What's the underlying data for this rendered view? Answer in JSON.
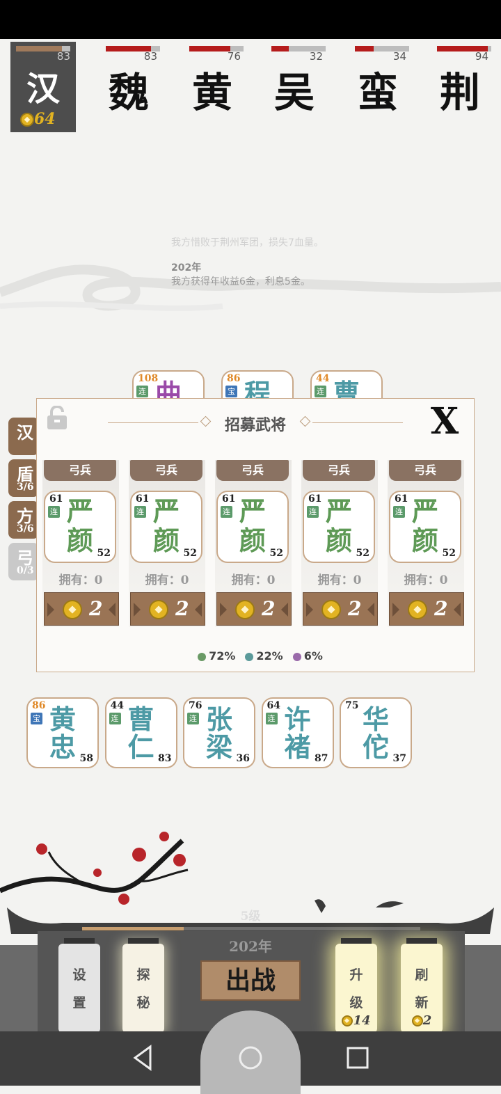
{
  "factions": [
    {
      "char": "汉",
      "hp": 83,
      "hp_ratio": 0.85,
      "gold": "64",
      "active": true
    },
    {
      "char": "魏",
      "hp": 83,
      "hp_ratio": 0.83
    },
    {
      "char": "黄",
      "hp": 76,
      "hp_ratio": 0.76
    },
    {
      "char": "吴",
      "hp": 32,
      "hp_ratio": 0.32
    },
    {
      "char": "蛮",
      "hp": 34,
      "hp_ratio": 0.34
    },
    {
      "char": "荆",
      "hp": 94,
      "hp_ratio": 0.94
    }
  ],
  "log": {
    "line1": "我方惜败于荆州军团，损失7血量。",
    "year": "202年",
    "line3": "我方获得年收益6金，利息5金。"
  },
  "top_cards": [
    {
      "level": "108",
      "tag": "连",
      "name": "曲"
    },
    {
      "level": "86",
      "tag": "宝",
      "name": "程"
    },
    {
      "level": "44",
      "tag": "连",
      "name": "曹"
    }
  ],
  "side_tabs": [
    {
      "t1": "汉",
      "t2": ""
    },
    {
      "t1": "盾",
      "t2": "3/6"
    },
    {
      "t1": "方",
      "t2": "3/6"
    },
    {
      "t1": "弓",
      "t2": "0/3"
    }
  ],
  "dialog": {
    "title": "招募武将",
    "close": "X",
    "slots": [
      {
        "type": "弓兵",
        "level": "61",
        "tag": "连",
        "name1": "严",
        "name2": "颜",
        "power": "52",
        "own": "拥有：0",
        "cost": "2"
      },
      {
        "type": "弓兵",
        "level": "61",
        "tag": "连",
        "name1": "严",
        "name2": "颜",
        "power": "52",
        "own": "拥有：0",
        "cost": "2"
      },
      {
        "type": "弓兵",
        "level": "61",
        "tag": "连",
        "name1": "严",
        "name2": "颜",
        "power": "52",
        "own": "拥有：0",
        "cost": "2"
      },
      {
        "type": "弓兵",
        "level": "61",
        "tag": "连",
        "name1": "严",
        "name2": "颜",
        "power": "52",
        "own": "拥有：0",
        "cost": "2"
      },
      {
        "type": "弓兵",
        "level": "61",
        "tag": "连",
        "name1": "严",
        "name2": "颜",
        "power": "52",
        "own": "拥有：0",
        "cost": "2"
      }
    ],
    "probs": [
      {
        "color": "#6a9a66",
        "label": "72%"
      },
      {
        "color": "#5b9a9a",
        "label": "22%"
      },
      {
        "color": "#9a6aaa",
        "label": "6%"
      }
    ]
  },
  "roster": [
    {
      "level": "86",
      "tag": "宝",
      "name1": "黄",
      "name2": "忠",
      "power": "58"
    },
    {
      "level": "44",
      "tag": "连",
      "name1": "曹",
      "name2": "仁",
      "power": "83"
    },
    {
      "level": "76",
      "tag": "连",
      "name1": "张",
      "name2": "梁",
      "power": "36"
    },
    {
      "level": "64",
      "tag": "连",
      "name1": "许",
      "name2": "褚",
      "power": "87"
    },
    {
      "level": "75",
      "tag": "",
      "name1": "华",
      "name2": "佗",
      "power": "37"
    }
  ],
  "bottom": {
    "level": "5级",
    "progress": 0.3,
    "year": "202年",
    "settings": [
      "设",
      "置"
    ],
    "explore": [
      "探",
      "秘"
    ],
    "fight": "出战",
    "upgrade": [
      "升",
      "级"
    ],
    "upgrade_cost": "14",
    "refresh": [
      "刷",
      "新"
    ],
    "refresh_cost": "2"
  }
}
